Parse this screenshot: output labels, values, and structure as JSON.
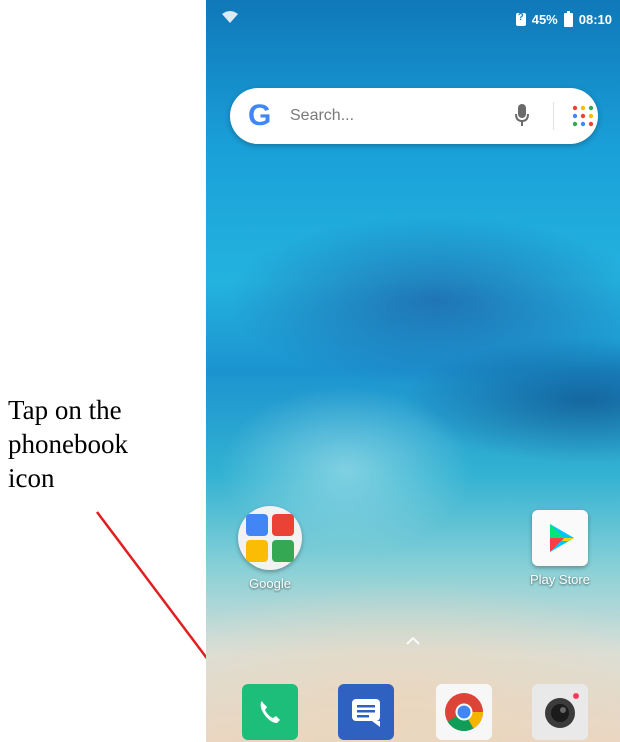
{
  "annotation": {
    "lines": [
      "Tap on the",
      "phonebook",
      "icon"
    ],
    "arrow_color": "#e02020"
  },
  "status_bar": {
    "battery": "45%",
    "time": "08:10",
    "icons": [
      "wifi-icon",
      "sim-alert-icon",
      "battery-icon"
    ]
  },
  "search": {
    "placeholder": "Search...",
    "icons": [
      "google-g-logo",
      "mic-icon",
      "app-grid-icon"
    ]
  },
  "home": {
    "apps": [
      {
        "label": "Google",
        "icon": "google-folder-icon"
      },
      {
        "label": "Play Store",
        "icon": "play-store-icon"
      }
    ]
  },
  "dock": [
    {
      "name": "Phone",
      "icon": "phone-icon",
      "color": "#1dbe79"
    },
    {
      "name": "Messages",
      "icon": "messages-icon",
      "color": "#2f62c0"
    },
    {
      "name": "Chrome",
      "icon": "chrome-icon"
    },
    {
      "name": "Camera",
      "icon": "camera-icon"
    }
  ]
}
